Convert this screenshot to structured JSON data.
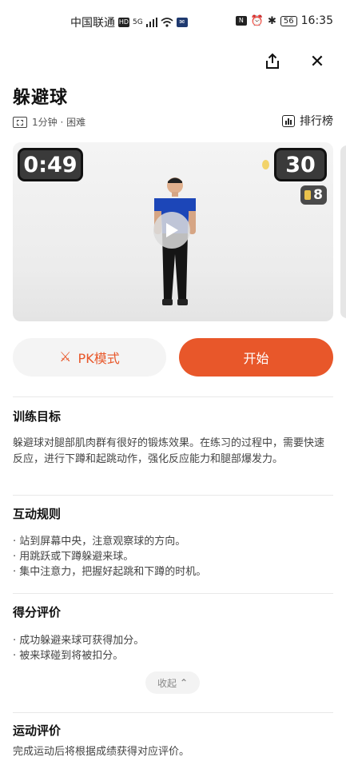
{
  "status_bar": {
    "carrier": "中国联通",
    "network": "5G",
    "battery": "56",
    "time": "16:35"
  },
  "header": {
    "share_icon": "share-icon",
    "close_icon": "close-icon",
    "close_glyph": "✕"
  },
  "exercise": {
    "title": "躲避球",
    "meta": "1分钟 · 困难",
    "leaderboard_label": "排行榜"
  },
  "video": {
    "timer": "0:49",
    "score": "30",
    "medal_count": "8"
  },
  "actions": {
    "pk_label": "PK模式",
    "pk_glyph": "⚔",
    "start_label": "开始"
  },
  "sections": {
    "goal": {
      "title": "训练目标",
      "text": "躲避球对腿部肌肉群有很好的锻炼效果。在练习的过程中，需要快速反应，进行下蹲和起跳动作，强化反应能力和腿部爆发力。"
    },
    "rules": {
      "title": "互动规则",
      "items": [
        "· 站到屏幕中央，注意观察球的方向。",
        "· 用跳跃或下蹲躲避来球。",
        "· 集中注意力，把握好起跳和下蹲的时机。"
      ]
    },
    "scoring": {
      "title": "得分评价",
      "items": [
        "· 成功躲避来球可获得加分。",
        "· 被来球碰到将被扣分。"
      ],
      "collapse_label": "收起",
      "collapse_glyph": "⌃"
    },
    "evaluation": {
      "title": "运动评价",
      "text": "完成运动后将根据成绩获得对应评价。"
    }
  },
  "colors": {
    "accent": "#e8572a"
  }
}
